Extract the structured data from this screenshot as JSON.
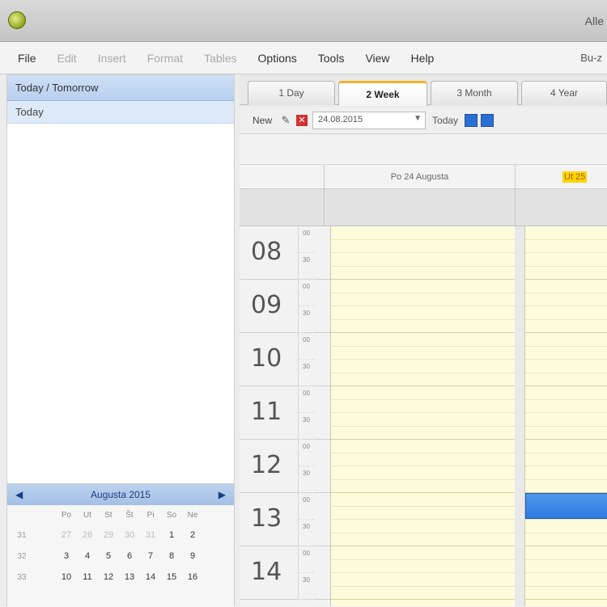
{
  "window": {
    "title": "Alle"
  },
  "menu": {
    "items": [
      {
        "label": "File",
        "enabled": true
      },
      {
        "label": "Edit",
        "enabled": false
      },
      {
        "label": "Insert",
        "enabled": false
      },
      {
        "label": "Format",
        "enabled": false
      },
      {
        "label": "Tables",
        "enabled": false
      },
      {
        "label": "Options",
        "enabled": true
      },
      {
        "label": "Tools",
        "enabled": true
      },
      {
        "label": "View",
        "enabled": true
      },
      {
        "label": "Help",
        "enabled": true
      }
    ],
    "right_text": "Bu-z"
  },
  "left": {
    "header": "Today / Tomorrow",
    "row": "Today"
  },
  "minical": {
    "month": "Augusta 2015",
    "prev": "◀",
    "next": "▶",
    "weekdays": [
      "Po",
      "Ut",
      "St",
      "Št",
      "Pi",
      "So",
      "Ne"
    ],
    "weeks": [
      {
        "num": "31",
        "days": [
          "27",
          "28",
          "29",
          "30",
          "31",
          "1",
          "2"
        ]
      },
      {
        "num": "32",
        "days": [
          "3",
          "4",
          "5",
          "6",
          "7",
          "8",
          "9"
        ]
      },
      {
        "num": "33",
        "days": [
          "10",
          "11",
          "12",
          "13",
          "14",
          "15",
          "16"
        ]
      }
    ]
  },
  "tabs": [
    {
      "label": "1 Day",
      "active": false
    },
    {
      "label": "2 Week",
      "active": true
    },
    {
      "label": "3 Month",
      "active": false
    },
    {
      "label": "4 Year",
      "active": false
    }
  ],
  "toolbar": {
    "new_label": "New",
    "date_value": "24.08.2015",
    "today_label": "Today"
  },
  "columns": [
    {
      "label": "Po 24 Augusta",
      "today": false
    },
    {
      "label": "Ut 25",
      "today": true
    }
  ],
  "hours": [
    {
      "hour": "08",
      "m1": "00",
      "m2": "30"
    },
    {
      "hour": "09",
      "m1": "00",
      "m2": "30"
    },
    {
      "hour": "10",
      "m1": "00",
      "m2": "30"
    },
    {
      "hour": "11",
      "m1": "00",
      "m2": "30"
    },
    {
      "hour": "12",
      "m1": "00",
      "m2": "30"
    },
    {
      "hour": "13",
      "m1": "00",
      "m2": "30"
    },
    {
      "hour": "14",
      "m1": "00",
      "m2": "30"
    }
  ],
  "colors": {
    "accent_tab": "#f4b22c",
    "event": "#2f7ce0",
    "day_bg": "#fdfbdc"
  }
}
